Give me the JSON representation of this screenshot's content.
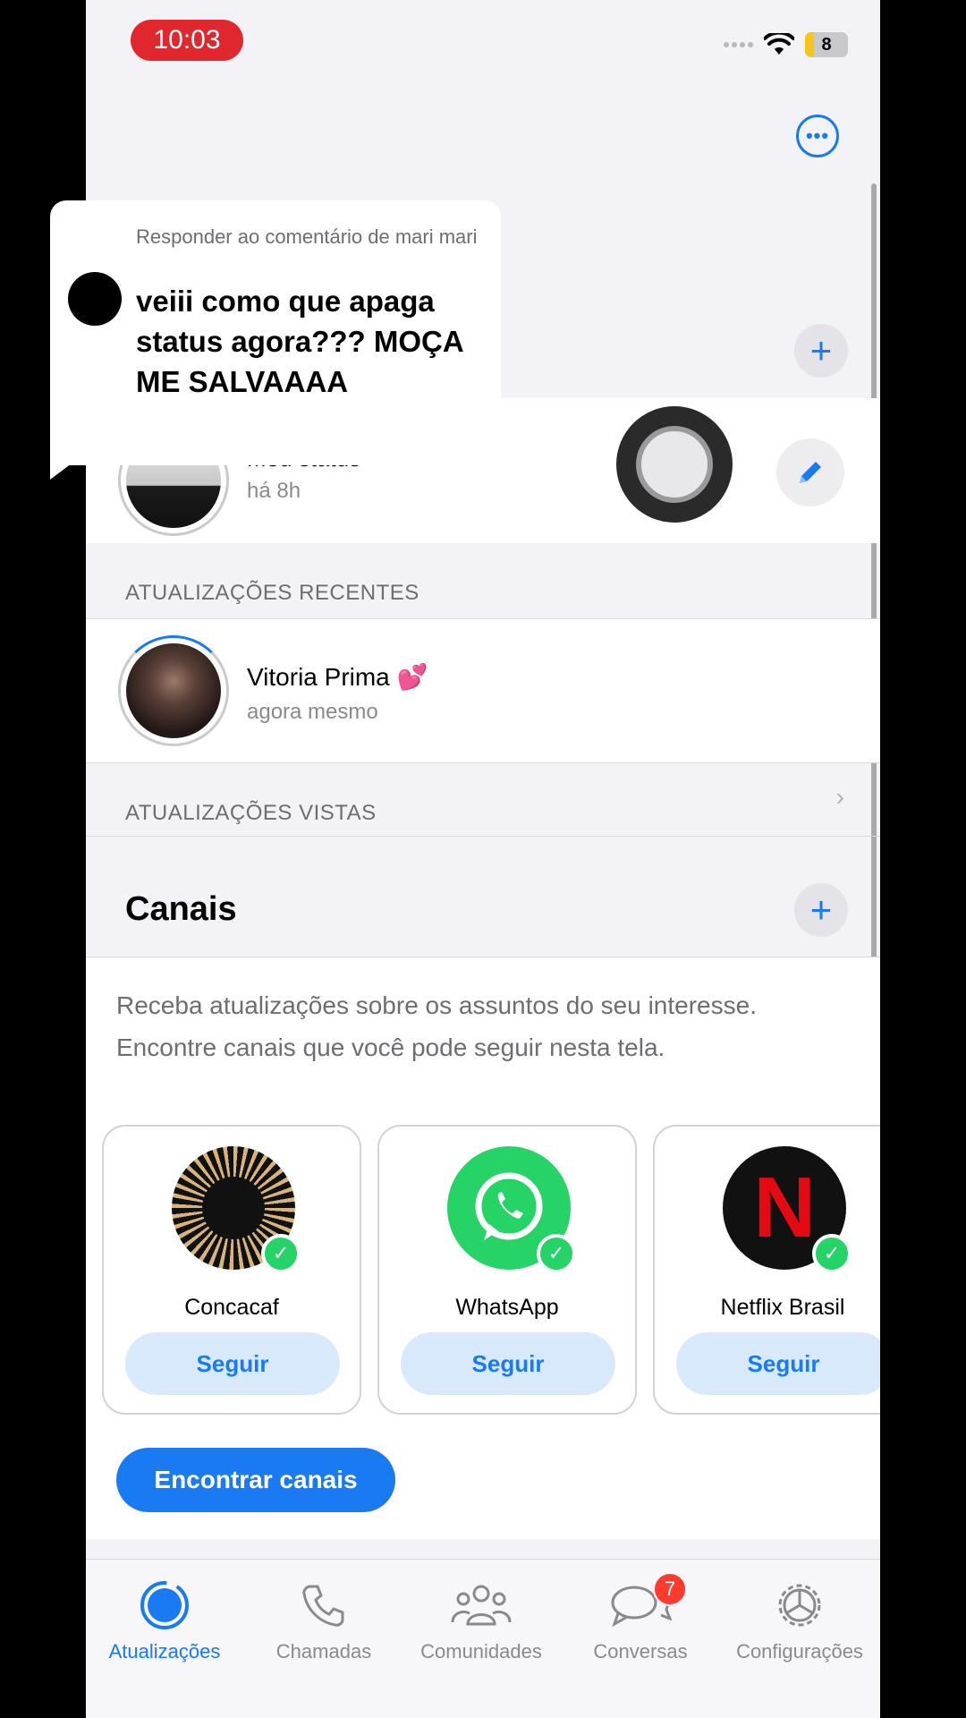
{
  "status_bar": {
    "time": "10:03",
    "battery": "8"
  },
  "status": {
    "my_status_title": "Meu status",
    "my_status_time": "há 8h",
    "recent_label": "ATUALIZAÇÕES RECENTES",
    "recent": [
      {
        "name": "Vitoria Prima 💕",
        "time": "agora mesmo"
      }
    ],
    "viewed_label": "ATUALIZAÇÕES VISTAS"
  },
  "channels": {
    "title": "Canais",
    "description": "Receba atualizações sobre os assuntos do seu interesse. Encontre canais que você pode seguir nesta tela.",
    "cards": [
      {
        "name": "Concacaf",
        "button": "Seguir"
      },
      {
        "name": "WhatsApp",
        "button": "Seguir"
      },
      {
        "name": "Netflix Brasil",
        "button": "Seguir",
        "logo_letter": "N"
      }
    ],
    "find_button": "Encontrar canais"
  },
  "tabs": [
    {
      "label": "Atualizações",
      "icon": "updates-icon",
      "active": true
    },
    {
      "label": "Chamadas",
      "icon": "phone-icon"
    },
    {
      "label": "Comunidades",
      "icon": "communities-icon"
    },
    {
      "label": "Conversas",
      "icon": "chat-bubbles-icon",
      "badge": "7"
    },
    {
      "label": "Configurações",
      "icon": "gear-icon"
    }
  ],
  "comment_overlay": {
    "header": "Responder ao comentário de mari mari",
    "text": "veiii como que apaga status agora??? MOÇA ME SALVAAAA"
  },
  "colors": {
    "accent": "#1a7af2",
    "whatsapp_green": "#25d366",
    "badge": "#ff3b30",
    "time_pill": "#e0272e"
  }
}
